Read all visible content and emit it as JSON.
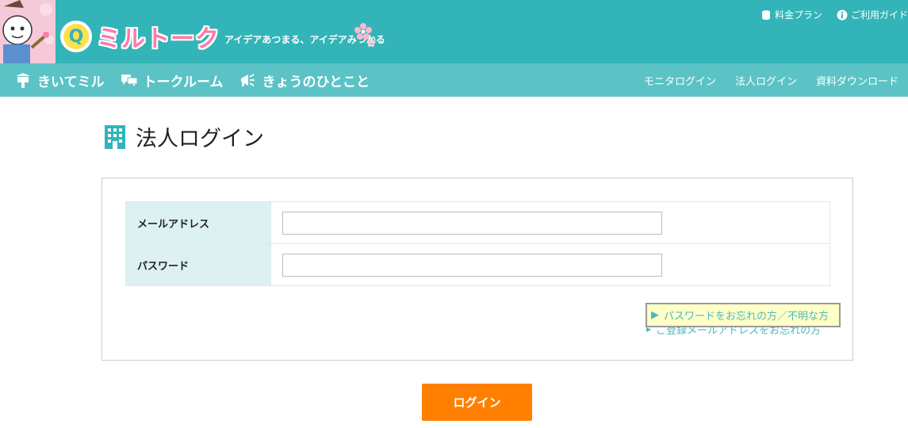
{
  "header": {
    "tagline": "アイデアあつまる、アイデアみつかる",
    "top_links": [
      {
        "label": "料金プラン",
        "icon": "coins-icon"
      },
      {
        "label": "ご利用ガイド",
        "icon": "info-icon"
      }
    ]
  },
  "nav": {
    "items": [
      {
        "label": "きいてミル",
        "icon": "signboard-icon"
      },
      {
        "label": "トークルーム",
        "icon": "chat-bubbles-icon"
      },
      {
        "label": "きょうのひとこと",
        "icon": "megaphone-icon"
      }
    ],
    "right_links": [
      "モニタログイン",
      "法人ログイン",
      "資料ダウンロード"
    ]
  },
  "page": {
    "title": "法人ログイン"
  },
  "form": {
    "email_label": "メールアドレス",
    "email_value": "",
    "password_label": "パスワード",
    "password_value": "",
    "forgot_password": "パスワードをお忘れの方／不明な方",
    "forgot_email": "ご登録メールアドレスをお忘れの方",
    "submit_label": "ログイン"
  },
  "colors": {
    "header_bg": "#33b4b8",
    "nav_bg": "#5bc3c6",
    "label_bg": "#ddf1f3",
    "link": "#4db8bd",
    "button": "#ff8000"
  }
}
